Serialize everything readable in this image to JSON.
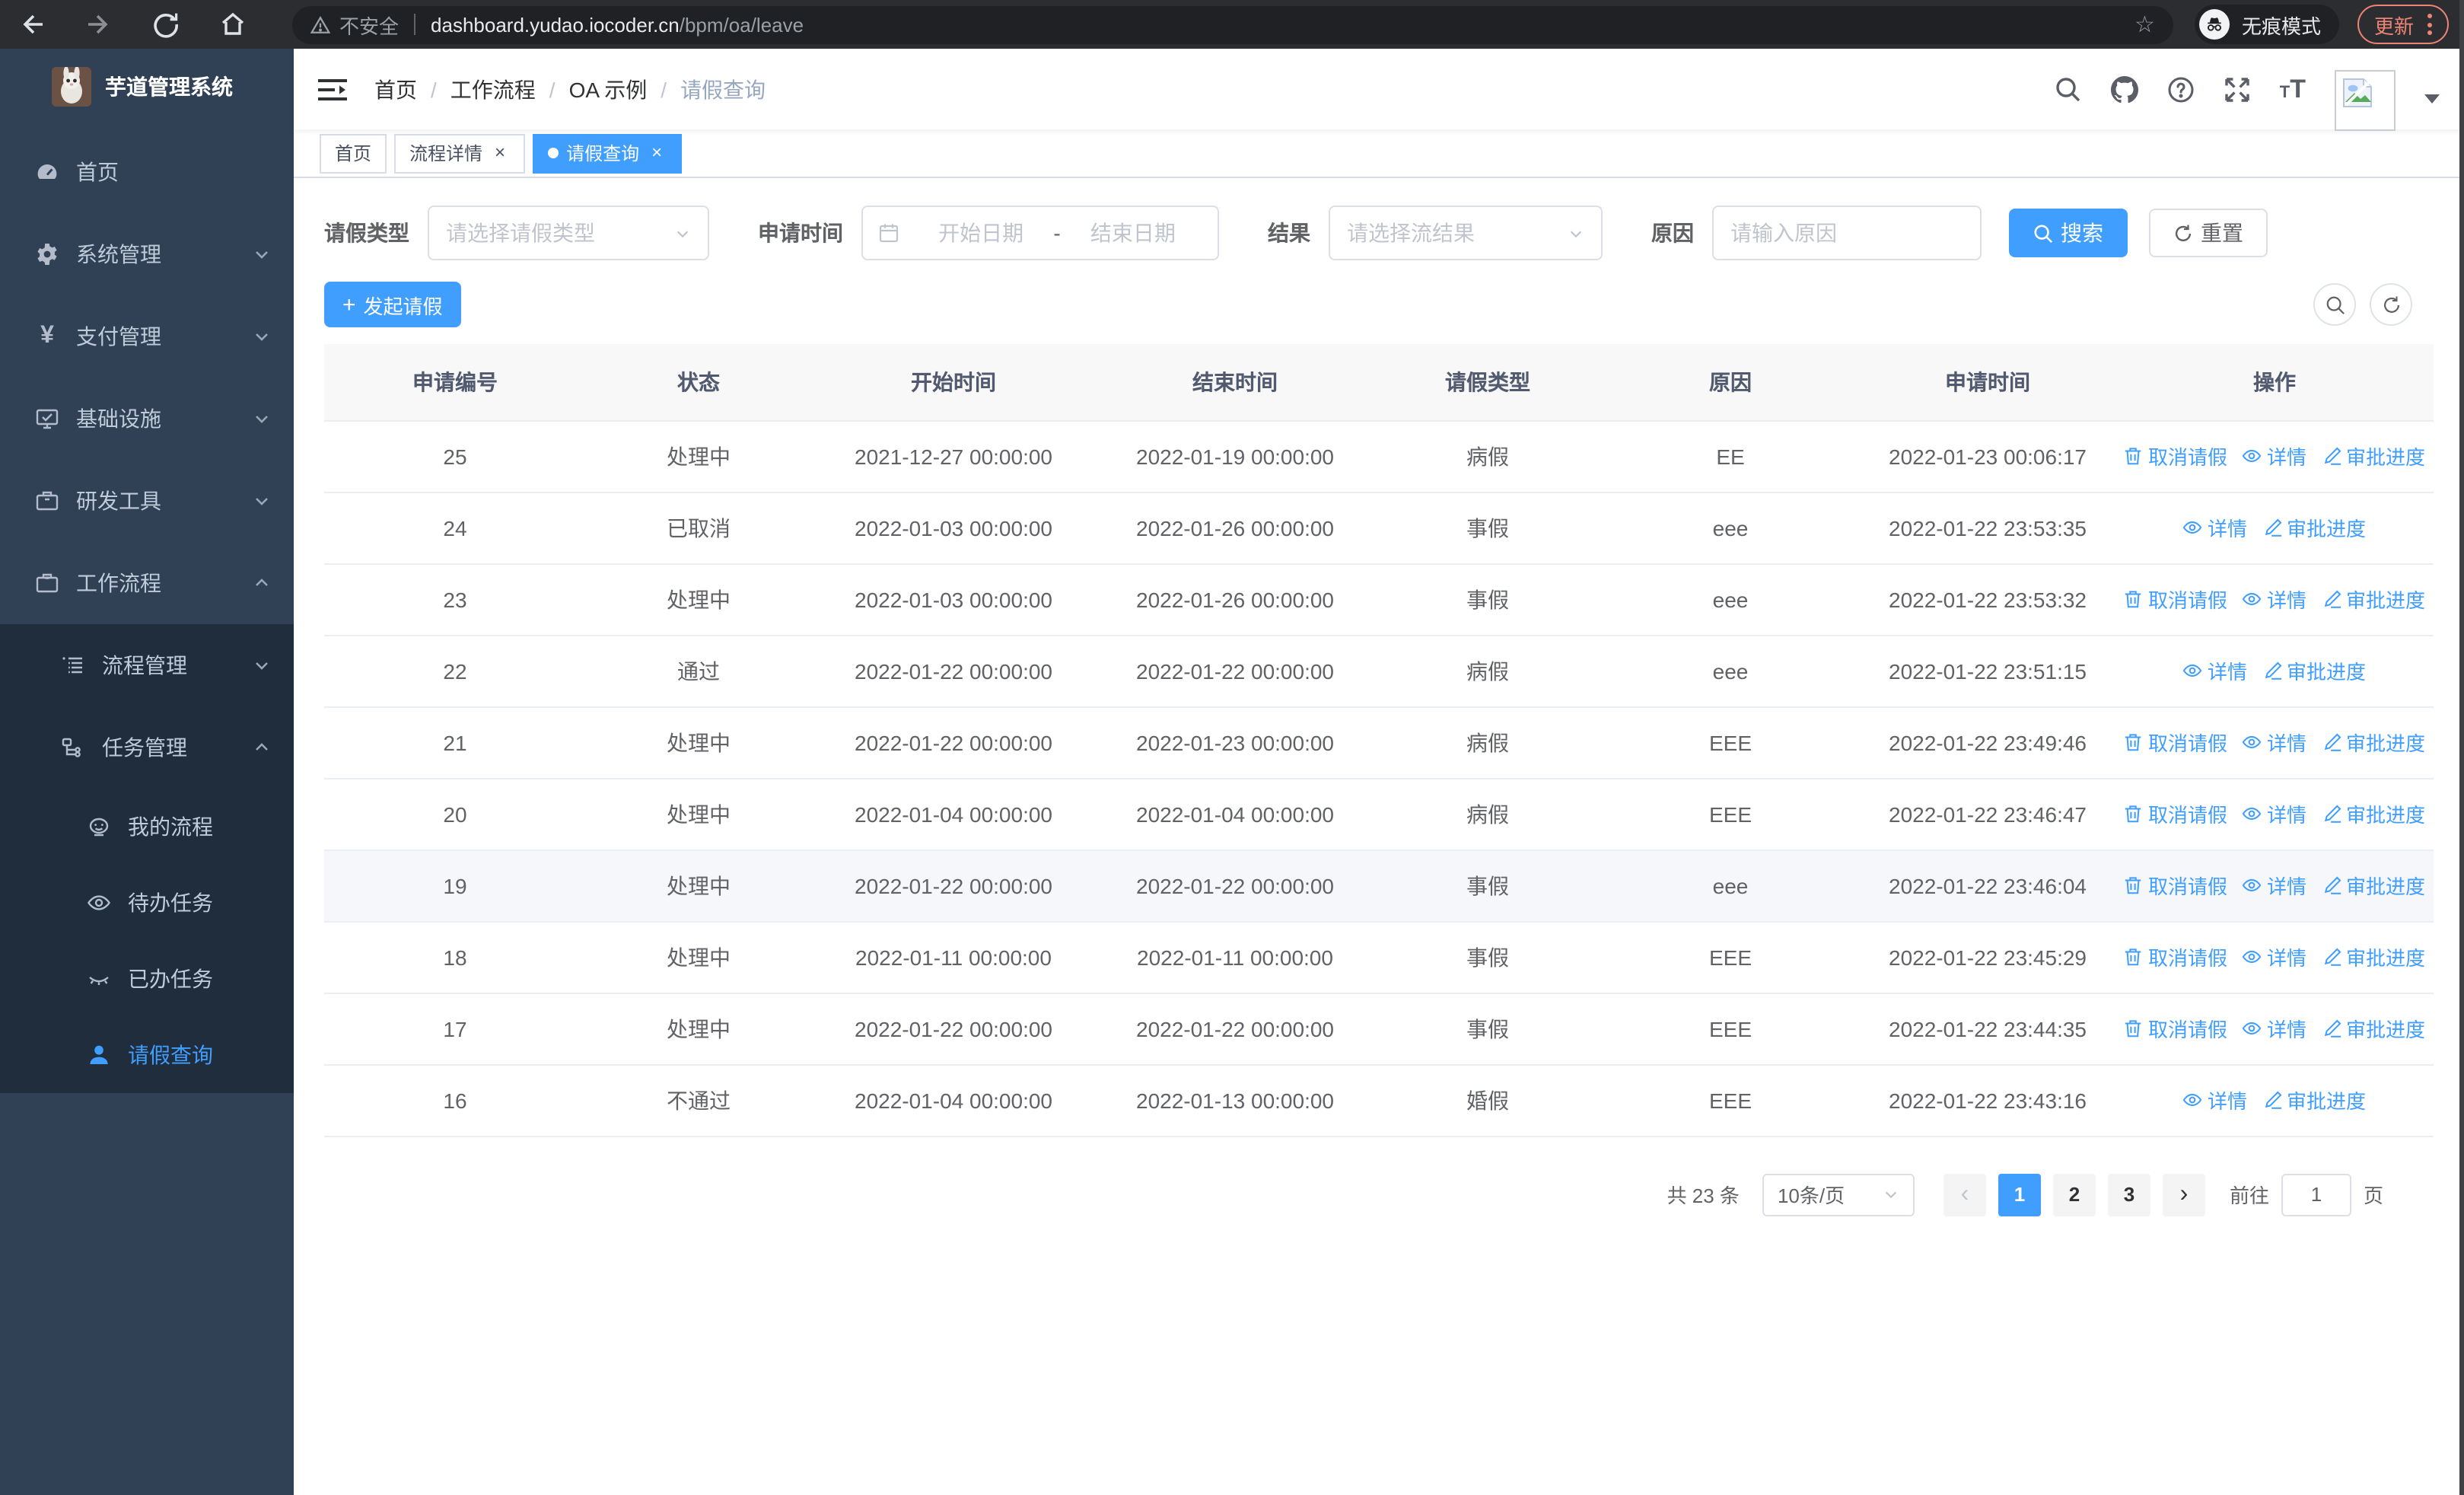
{
  "colors": {
    "accent": "#409eff",
    "sidebar_bg": "#304156",
    "submenu_bg": "#1f2d3d",
    "update_badge": "#ee8476",
    "table_header_bg": "#f8f8f9"
  },
  "browser": {
    "security_warning": "不安全",
    "url_host": "dashboard.yudao.iocoder.cn",
    "url_path": "/bpm/oa/leave",
    "incognito_label": "无痕模式",
    "update_label": "更新"
  },
  "sidebar": {
    "app_title": "芋道管理系统",
    "items": [
      {
        "label": "首页"
      },
      {
        "label": "系统管理"
      },
      {
        "label": "支付管理"
      },
      {
        "label": "基础设施"
      },
      {
        "label": "研发工具"
      },
      {
        "label": "工作流程"
      },
      {
        "label": "流程管理"
      },
      {
        "label": "任务管理"
      },
      {
        "label": "我的流程"
      },
      {
        "label": "待办任务"
      },
      {
        "label": "已办任务"
      },
      {
        "label": "请假查询"
      }
    ]
  },
  "breadcrumb": {
    "items": [
      "首页",
      "工作流程",
      "OA 示例",
      "请假查询"
    ]
  },
  "tabs": [
    {
      "label": "首页"
    },
    {
      "label": "流程详情"
    },
    {
      "label": "请假查询"
    }
  ],
  "filters": {
    "leave_type_label": "请假类型",
    "leave_type_placeholder": "请选择请假类型",
    "apply_time_label": "申请时间",
    "date_start_placeholder": "开始日期",
    "date_separator": "-",
    "date_end_placeholder": "结束日期",
    "result_label": "结果",
    "result_placeholder": "请选择流结果",
    "reason_label": "原因",
    "reason_placeholder": "请输入原因",
    "search_label": "搜索",
    "reset_label": "重置"
  },
  "toolbar": {
    "create_label": "发起请假"
  },
  "table": {
    "columns": [
      "申请编号",
      "状态",
      "开始时间",
      "结束时间",
      "请假类型",
      "原因",
      "申请时间",
      "操作"
    ],
    "column_keys": [
      "id",
      "status",
      "start",
      "end",
      "type",
      "reason",
      "apply_time"
    ],
    "action_labels": {
      "cancel": "取消请假",
      "detail": "详情",
      "progress": "审批进度"
    },
    "hover_row_id": 19,
    "rows": [
      {
        "id": 25,
        "status": "处理中",
        "start": "2021-12-27 00:00:00",
        "end": "2022-01-19 00:00:00",
        "type": "病假",
        "reason": "EE",
        "apply_time": "2022-01-23 00:06:17",
        "actions": [
          "cancel",
          "detail",
          "progress"
        ]
      },
      {
        "id": 24,
        "status": "已取消",
        "start": "2022-01-03 00:00:00",
        "end": "2022-01-26 00:00:00",
        "type": "事假",
        "reason": "eee",
        "apply_time": "2022-01-22 23:53:35",
        "actions": [
          "detail",
          "progress"
        ]
      },
      {
        "id": 23,
        "status": "处理中",
        "start": "2022-01-03 00:00:00",
        "end": "2022-01-26 00:00:00",
        "type": "事假",
        "reason": "eee",
        "apply_time": "2022-01-22 23:53:32",
        "actions": [
          "cancel",
          "detail",
          "progress"
        ]
      },
      {
        "id": 22,
        "status": "通过",
        "start": "2022-01-22 00:00:00",
        "end": "2022-01-22 00:00:00",
        "type": "病假",
        "reason": "eee",
        "apply_time": "2022-01-22 23:51:15",
        "actions": [
          "detail",
          "progress"
        ]
      },
      {
        "id": 21,
        "status": "处理中",
        "start": "2022-01-22 00:00:00",
        "end": "2022-01-23 00:00:00",
        "type": "病假",
        "reason": "EEE",
        "apply_time": "2022-01-22 23:49:46",
        "actions": [
          "cancel",
          "detail",
          "progress"
        ]
      },
      {
        "id": 20,
        "status": "处理中",
        "start": "2022-01-04 00:00:00",
        "end": "2022-01-04 00:00:00",
        "type": "病假",
        "reason": "EEE",
        "apply_time": "2022-01-22 23:46:47",
        "actions": [
          "cancel",
          "detail",
          "progress"
        ]
      },
      {
        "id": 19,
        "status": "处理中",
        "start": "2022-01-22 00:00:00",
        "end": "2022-01-22 00:00:00",
        "type": "事假",
        "reason": "eee",
        "apply_time": "2022-01-22 23:46:04",
        "actions": [
          "cancel",
          "detail",
          "progress"
        ]
      },
      {
        "id": 18,
        "status": "处理中",
        "start": "2022-01-11 00:00:00",
        "end": "2022-01-11 00:00:00",
        "type": "事假",
        "reason": "EEE",
        "apply_time": "2022-01-22 23:45:29",
        "actions": [
          "cancel",
          "detail",
          "progress"
        ]
      },
      {
        "id": 17,
        "status": "处理中",
        "start": "2022-01-22 00:00:00",
        "end": "2022-01-22 00:00:00",
        "type": "事假",
        "reason": "EEE",
        "apply_time": "2022-01-22 23:44:35",
        "actions": [
          "cancel",
          "detail",
          "progress"
        ]
      },
      {
        "id": 16,
        "status": "不通过",
        "start": "2022-01-04 00:00:00",
        "end": "2022-01-13 00:00:00",
        "type": "婚假",
        "reason": "EEE",
        "apply_time": "2022-01-22 23:43:16",
        "actions": [
          "detail",
          "progress"
        ]
      }
    ]
  },
  "pagination": {
    "total": "共 23 条",
    "page_size": "10条/页",
    "pages": [
      "1",
      "2",
      "3"
    ],
    "active_page": "1",
    "goto_label": "前往",
    "goto_value": "1",
    "unit_label": "页"
  }
}
